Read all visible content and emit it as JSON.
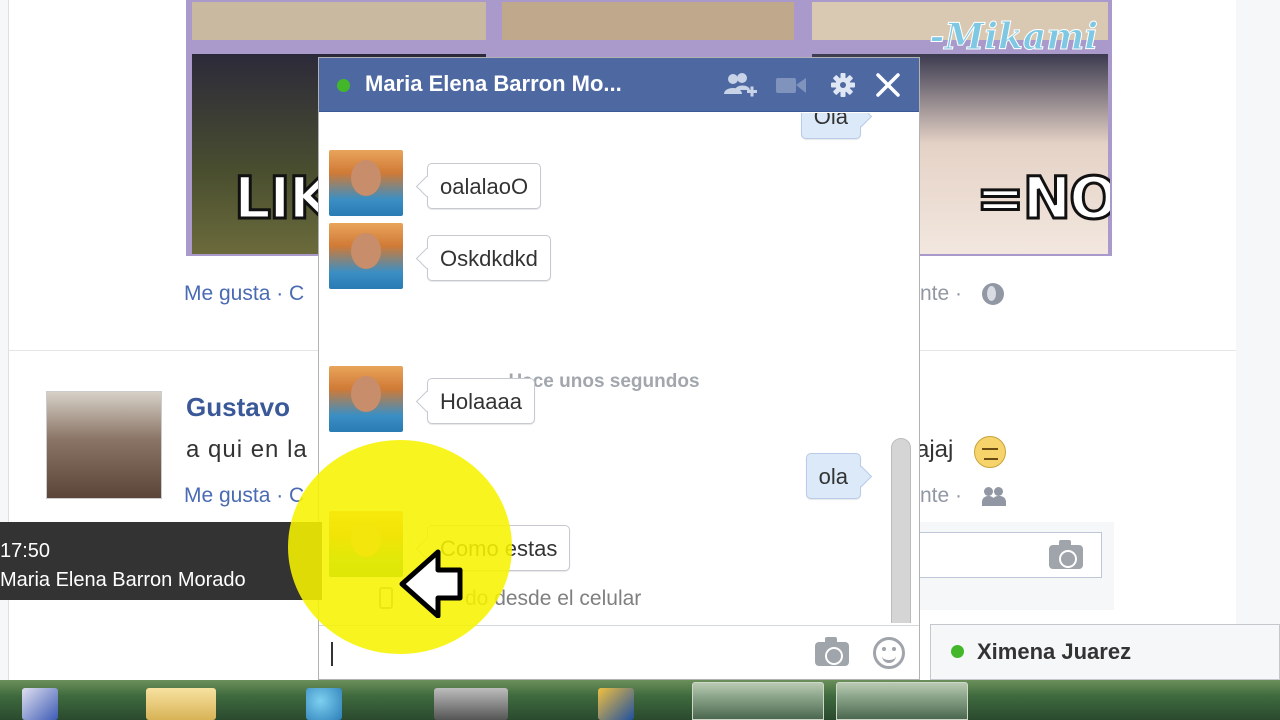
{
  "feed": {
    "meme_left_text": "LIK",
    "meme_right_text": "=NO",
    "meme_watermark": "-Mikami",
    "post1_like": "Me gusta · C",
    "post1_comment_end": "nte ·",
    "post2_author": "Gustavo",
    "post2_text_start": "a qui en la",
    "post2_text_end": "ajaj",
    "post2_like": "Me gusta · C",
    "post2_comment_end": "nte ·"
  },
  "tooltip": {
    "time": "17:50",
    "name": "Maria Elena Barron Morado"
  },
  "chat": {
    "title": "Maria Elena Barron Mo...",
    "status_color": "#42b72a",
    "messages": [
      {
        "text": "Ola",
        "from": "me"
      },
      {
        "text": "oalalaoO",
        "from": "them"
      },
      {
        "text": "Oskdkdkd",
        "from": "them"
      },
      {
        "text": "Holaaaa",
        "from": "them"
      },
      {
        "text": "ola",
        "from": "me"
      },
      {
        "text": "Como estas",
        "from": "them"
      }
    ],
    "time_divider": "Hace unos segundos",
    "sent_from": "Enviado desde el celular",
    "sent_from_visible": "do desde el celular",
    "composer_value": "",
    "header_icons": [
      "add-friends-icon",
      "video-icon",
      "gear-icon",
      "close-icon"
    ]
  },
  "chat_tab": {
    "name": "Ximena Juarez"
  },
  "colors": {
    "header_blue": "#4e69a2",
    "highlight_yellow": "#f7f200"
  }
}
